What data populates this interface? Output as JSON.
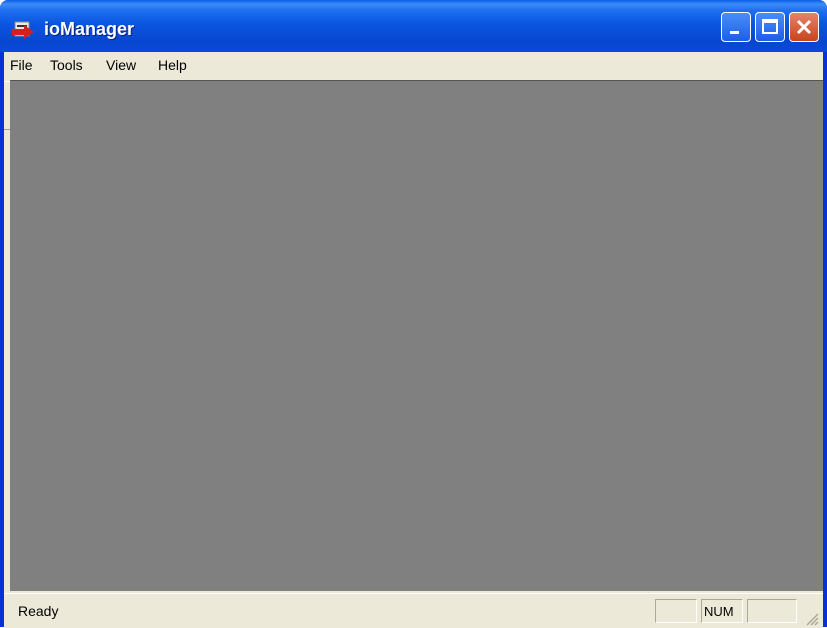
{
  "window": {
    "title": "ioManager"
  },
  "menu": {
    "items": [
      "File",
      "Tools",
      "View",
      "Help"
    ]
  },
  "toolbar": {
    "buttons": [
      {
        "name": "new-icon",
        "enabled": true
      },
      {
        "name": "open-icon",
        "enabled": true
      },
      {
        "name": "save-icon",
        "enabled": false
      },
      {
        "name": "cut-icon",
        "enabled": false
      },
      {
        "name": "copy-icon",
        "enabled": false
      },
      {
        "name": "paste-icon",
        "enabled": false
      },
      {
        "name": "find-icon",
        "enabled": true
      },
      {
        "name": "monitor-icon",
        "enabled": true
      },
      {
        "name": "help-icon",
        "enabled": true
      }
    ]
  },
  "status": {
    "text": "Ready",
    "panes": [
      "",
      "NUM",
      ""
    ]
  }
}
